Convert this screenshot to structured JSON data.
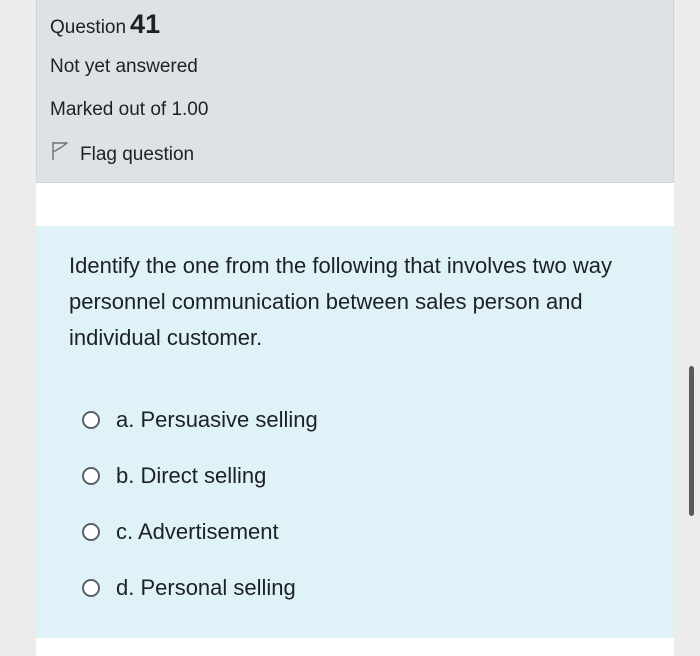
{
  "question": {
    "label": "Question",
    "number": "41",
    "state": "Not yet answered",
    "grade": "Marked out of 1.00",
    "flag_label": "Flag question",
    "text": "Identify the one from the following that involves two way personnel communication between sales person and individual customer."
  },
  "answers": [
    {
      "label": "a. Persuasive selling"
    },
    {
      "label": "b. Direct selling"
    },
    {
      "label": "c. Advertisement"
    },
    {
      "label": "d. Personal selling"
    }
  ],
  "colors": {
    "info_bg": "#dee2e6",
    "content_bg": "#def2f8"
  },
  "icons": {
    "flag": "flag-icon"
  }
}
